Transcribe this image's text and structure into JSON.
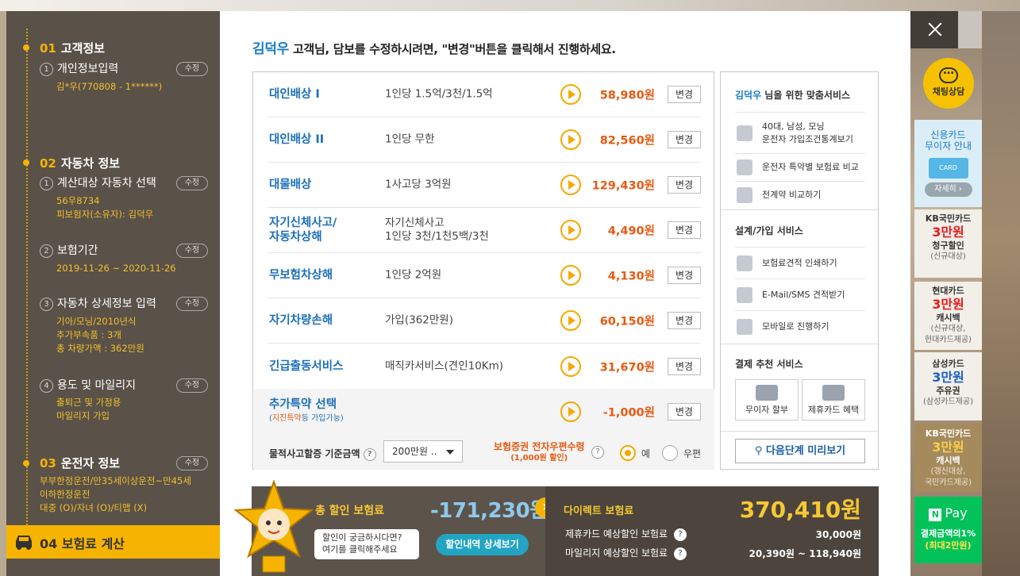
{
  "sidebar": {
    "sections": [
      {
        "num": "01",
        "title": "고객정보"
      },
      {
        "num": "02",
        "title": "자동차 정보"
      },
      {
        "num": "03",
        "title": "운전자 정보"
      }
    ],
    "edit_label": "수정",
    "items": {
      "personal": {
        "num": "1",
        "label": "개인정보입력",
        "detail": "김*우(770808 - 1******)"
      },
      "vehicle": {
        "num": "1",
        "label": "계산대상 자동차 선택",
        "detail1": "56우8734",
        "detail2": "피보험자(소유자): 김덕우"
      },
      "period": {
        "num": "2",
        "label": "보험기간",
        "detail": "2019-11-26 ~ 2020-11-26"
      },
      "car_detail": {
        "num": "3",
        "label": "자동차 상세정보 입력",
        "detail1": "기아/모닝/2010년식",
        "detail2": "추가부속품 : 3개",
        "detail3": "총 차량가액 : 362만원"
      },
      "usage": {
        "num": "4",
        "label": "용도 및 마일리지",
        "detail1": "출퇴근 및 가정용",
        "detail2": "마일리지 가입"
      },
      "driver": {
        "detail1": "부부한정운전/만35세이상운전~만45세",
        "detail2": "이하한정운전",
        "detail3": "대중 (O)/자녀 (O)/티맵 (X)"
      }
    },
    "current_step": {
      "num": "04",
      "title": "보험료 계산"
    }
  },
  "header": {
    "name": "김덕우",
    "message": " 고객님, 담보를 수정하시려면, \"변경\"버튼을 클릭해서 진행하세요."
  },
  "coverages": {
    "change_label": "변경",
    "rows": [
      {
        "title": "대인배상 I",
        "desc": "1인당 1.5억/3천/1.5억",
        "price": "58,980원"
      },
      {
        "title": "대인배상 II",
        "desc": "1인당 무한",
        "price": "82,560원"
      },
      {
        "title": "대물배상",
        "desc": "1사고당 3억원",
        "price": "129,430원"
      },
      {
        "title1": "자기신체사고/",
        "title2": "자동차상해",
        "desc1": "자기신체사고",
        "desc2": "1인당 3천/1천5백/3천",
        "price": "4,490원"
      },
      {
        "title": "무보험차상해",
        "desc": "1인당 2억원",
        "price": "4,130원"
      },
      {
        "title": "자기차량손해",
        "desc": "가입(362만원)",
        "price": "60,150원"
      },
      {
        "title": "긴급출동서비스",
        "desc": "매직카서비스(견인10Km)",
        "price": "31,670원"
      }
    ],
    "special": {
      "title": "추가특약 선택",
      "note_pre": "(",
      "note_hl": "지진특약",
      "note_post": "등 가입가능)",
      "price": "-1,000원"
    },
    "option": {
      "property_label": "물적사고할증 기준금액",
      "property_value": "200만원 ..",
      "cert_label": "보험증권 전자우편수령",
      "cert_sub": "(1,000원 할인)",
      "yes": "예",
      "no": "우편"
    }
  },
  "services": {
    "title_name": "김덕우",
    "title_suffix": " 님을 위한 맞춤서비스",
    "custom": [
      {
        "icon": "person-icon",
        "line1": "40대, 남성, 모닝",
        "line2": "운전자 가입조건통계보기"
      },
      {
        "icon": "gauge-icon",
        "line1": "운전자 특약별 보험료 비교"
      },
      {
        "icon": "document-icon",
        "line1": "전계약 비교하기"
      }
    ],
    "design_title": "설계/가입 서비스",
    "design": [
      {
        "icon": "printer-icon",
        "label": "보험료견적 인쇄하기"
      },
      {
        "icon": "mail-icon",
        "label": "E-Mail/SMS 견적받기"
      },
      {
        "icon": "mobile-icon",
        "label": "모바일로 진행하기"
      }
    ],
    "pay_title": "결제 추천 서비스",
    "pay_boxes": [
      {
        "icon": "coins-icon",
        "label": "무이자 할부"
      },
      {
        "icon": "card-icon",
        "label": "제휴카드 혜택"
      }
    ],
    "next_label": "다음단계 미리보기"
  },
  "summary": {
    "total_label": "총 할인 보험료",
    "total_value": "-171,230원",
    "bubble1": "할인이 궁금하시다면?",
    "bubble2": "여기를 클릭해주세요",
    "detail_btn": "할인내역 상세보기",
    "direct_label": "다이렉트 보험료",
    "direct_value": "370,410원",
    "card_label": "제휴카드 예상할인 보험료",
    "card_value": "30,000원",
    "mileage_label": "마일리지 예상할인 보험료",
    "mileage_value": "20,390원  ~  118,940원"
  },
  "rail": {
    "chat": "채팅상담",
    "card1": {
      "t1": "신용카드",
      "t2": "무이자 안내",
      "card": "CARD",
      "btn": "자세히 ›"
    },
    "card2": {
      "t1": "KB국민카드",
      "t2": "3만원",
      "t3": "청구할인",
      "t4": "(신규대상)"
    },
    "card3": {
      "t1": "현대카드",
      "t2": "3만원",
      "t3": "캐시백",
      "t4": "(신규대상,",
      "t5": "현대카드제공)"
    },
    "card4": {
      "t1": "삼성카드",
      "t2": "3만원",
      "t3": "주유권",
      "t4": "(삼성카드제공)"
    },
    "card5": {
      "t1": "KB국민카드",
      "t2": "3만원",
      "t3": "캐시백",
      "t4": "(갱신대상,",
      "t5": "국민카드제공)"
    },
    "card6": {
      "n": "N",
      "pay": "Pay",
      "t1": "결제금액의1%",
      "t2": "(최대2만원)"
    }
  }
}
